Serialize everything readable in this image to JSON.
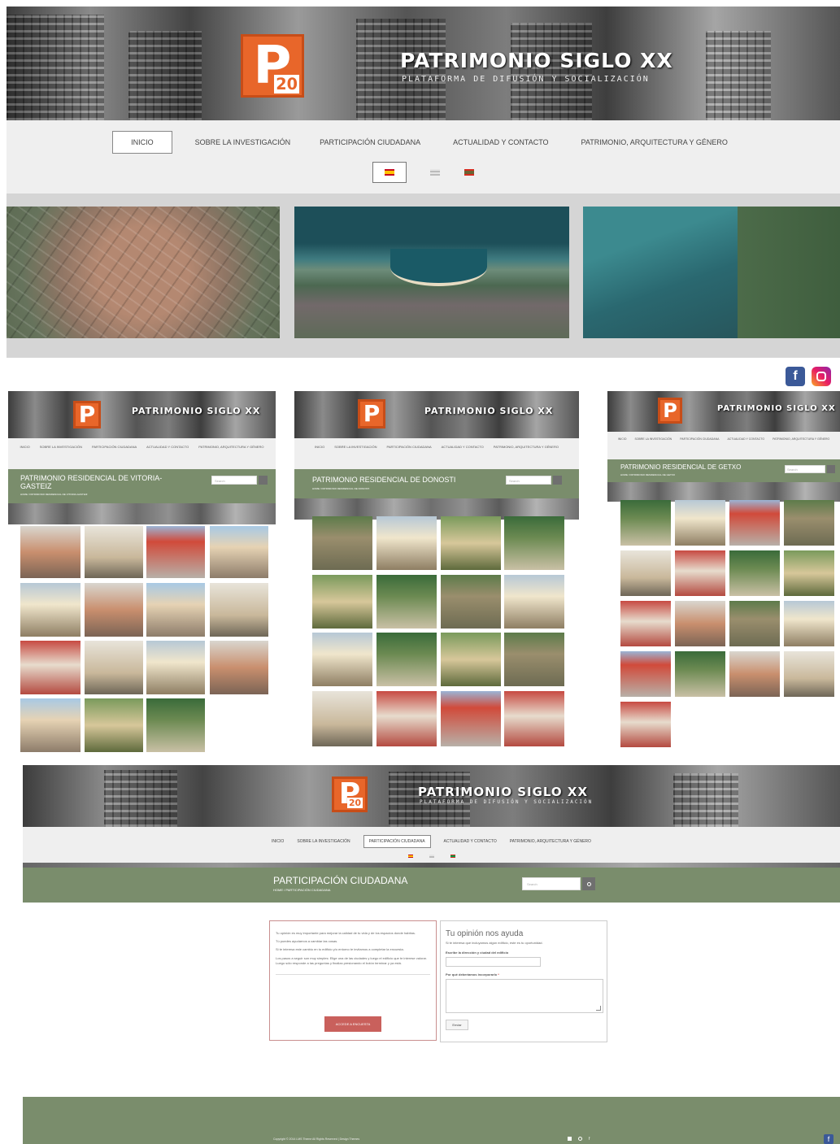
{
  "site": {
    "brand": "PATRIMONIO SIGLO XX",
    "tagline": "PLATAFORMA DE DIFUSIÓN Y SOCIALIZACIÓN",
    "logo_letter": "P",
    "logo_number": "20"
  },
  "nav": {
    "items": [
      "INICIO",
      "SOBRE LA INVESTIGACIÓN",
      "PARTICIPACIÓN CIUDADANA",
      "ACTUALIDAD Y CONTACTO",
      "PATRIMONIO, ARQUITECTURA Y GÉNERO"
    ],
    "active_main": "INICIO",
    "languages": [
      "es-flag-icon",
      "en-flag-icon",
      "eu-flag-icon"
    ]
  },
  "social": [
    "facebook-icon",
    "instagram-icon"
  ],
  "cards": {
    "vitoria": {
      "title": "PATRIMONIO RESIDENCIAL DE VITORIA-GASTEIZ",
      "breadcrumb": "HOME / PATRIMONIO RESIDENCIAL DE VITORIA-GASTEIZ",
      "search_placeholder": "Search"
    },
    "donosti": {
      "title": "PATRIMONIO RESIDENCIAL DE DONOSTI",
      "breadcrumb": "HOME / PATRIMONIO RESIDENCIAL DE DONOSTI",
      "search_placeholder": "Search"
    },
    "getxo": {
      "title": "PATRIMONIO RESIDENCIAL DE GETXO",
      "breadcrumb": "HOME / PATRIMONIO RESIDENCIAL DE GETXO",
      "search_placeholder": "Search"
    }
  },
  "participacion": {
    "title": "PARTICIPACIÓN CIUDADANA",
    "breadcrumb": "HOME / PARTICIPACIÓN CIUDADANA",
    "search_placeholder": "Search",
    "left_paragraphs": [
      "Tu opinión es muy importante para mejorar la calidad de tu vida y de los espacios donde habitas.",
      "Tú puedes ayudarnos a cambiar las cosas.",
      "Si te interesa este cambio en tu edificio y/o entorno te invitamos a completar la encuesta.",
      "Los pasos a seguir son muy simples: Elige una de las ciudades y luego el edificio que te interese valorar. Luego sólo responde a las preguntas y finaliza presionando el botón terminar y ya está."
    ],
    "survey_button": "ACCEDE A ENCUESTA",
    "form_title": "Tu opinión nos ayuda",
    "form_intro": "Si te interesa que incluyamos algún edificio, este es tu oportunidad.",
    "field1_label": "Escribe la dirección y ciudad del edificio",
    "field2_label": "Por qué deberíamos incorporarlo",
    "required_mark": "*",
    "submit": "Enviar"
  },
  "footer": {
    "copyright": "Copyright © 2014 LMS Theme All Rights Reserved | Design Themes"
  },
  "colors": {
    "green": "#7a8d6c",
    "orange": "#e8662a",
    "pink_button": "#c9605c"
  }
}
